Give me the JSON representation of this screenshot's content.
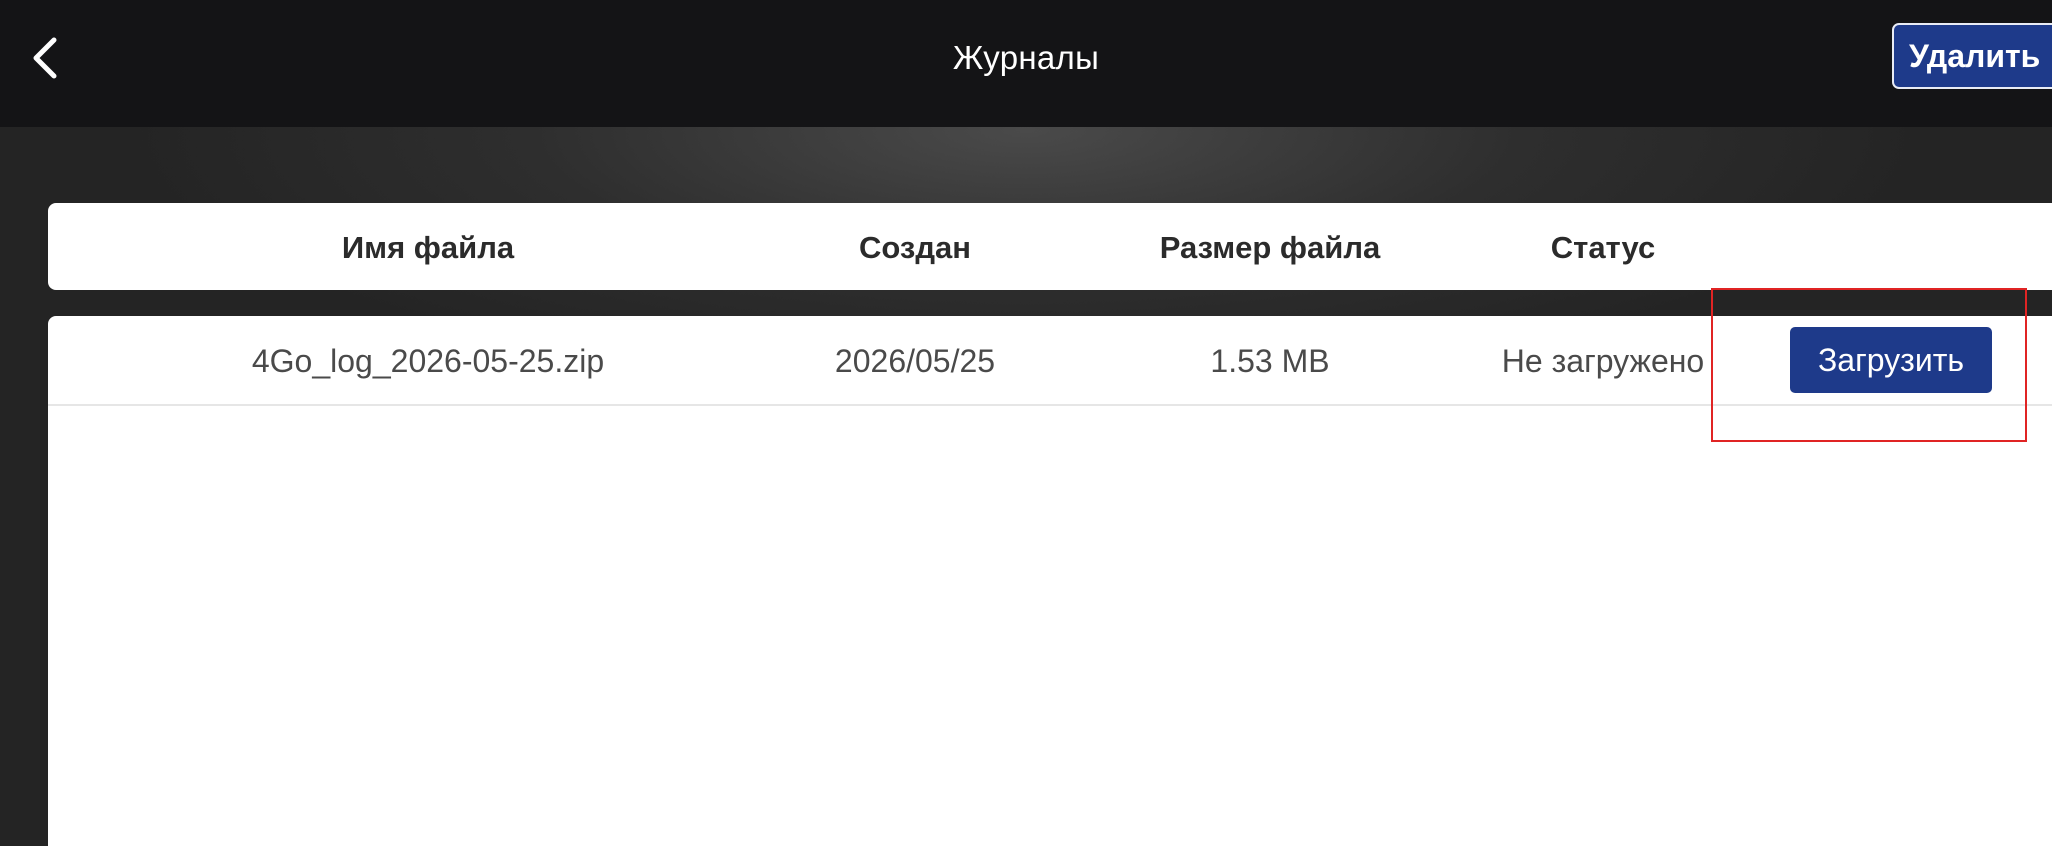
{
  "header": {
    "title": "Журналы",
    "back_icon": "chevron-left-icon",
    "delete_label": "Удалить"
  },
  "table": {
    "columns": [
      "Имя файла",
      "Создан",
      "Размер файла",
      "Статус"
    ],
    "rows": [
      {
        "filename": "4Go_log_2026-05-25.zip",
        "created": "2026/05/25",
        "size": "1.53 MB",
        "status": "Не загружено",
        "action_label": "Загрузить"
      }
    ]
  },
  "colors": {
    "topbar": "#141416",
    "accent": "#1e3a8a",
    "highlight": "#e02424"
  }
}
